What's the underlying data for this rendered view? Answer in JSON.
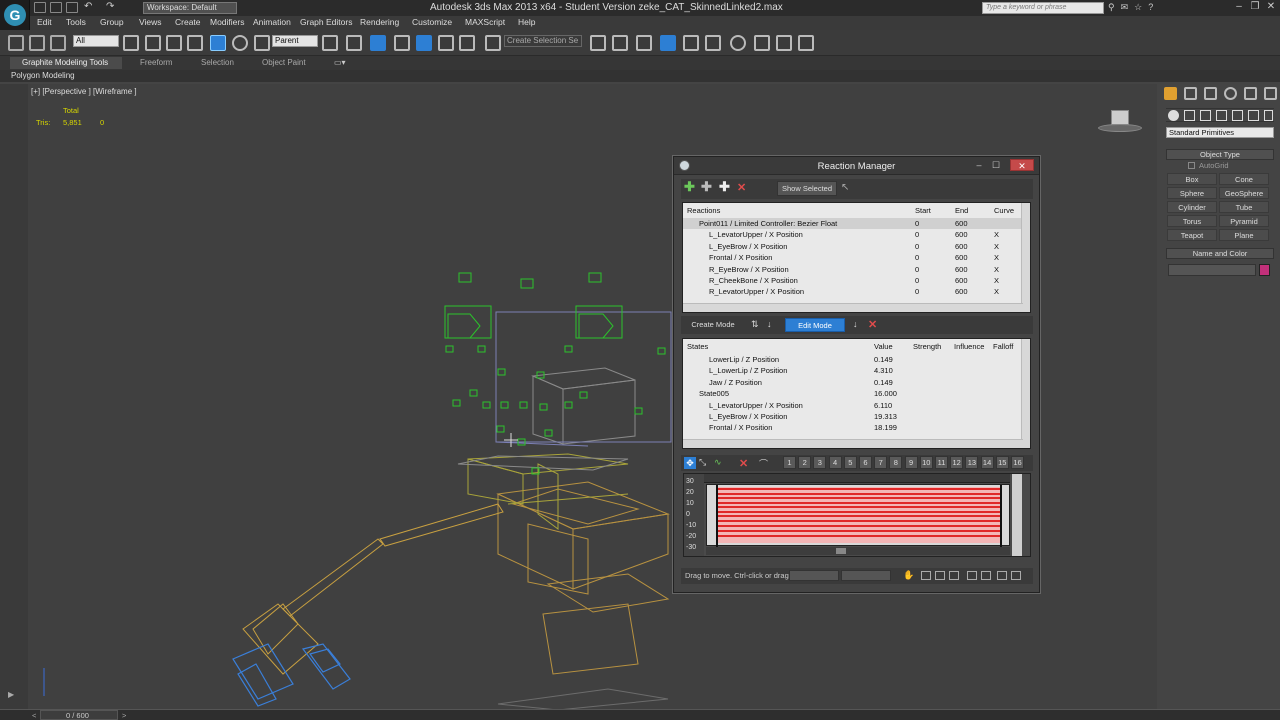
{
  "window": {
    "title": "Autodesk 3ds Max  2013 x64   -  Student Version    zeke_CAT_SkinnedLinked2.max",
    "workspace": "Workspace: Default",
    "help_placeholder": "Type a keyword or phrase"
  },
  "menu": [
    "Edit",
    "Tools",
    "Group",
    "Views",
    "Create",
    "Modifiers",
    "Animation",
    "Graph Editors",
    "Rendering",
    "Customize",
    "MAXScript",
    "Help"
  ],
  "toolbar": {
    "filter": "All",
    "link_mode": "Parent",
    "selection_set": "Create Selection Se"
  },
  "ribbon": {
    "tabs": [
      "Graphite Modeling Tools",
      "Freeform",
      "Selection",
      "Object Paint"
    ],
    "sub_label": "Polygon Modeling"
  },
  "viewport": {
    "label": "[+] [Perspective ] [Wireframe ]",
    "stats_total_label": "Total",
    "stats_tris_label": "Tris:",
    "stats_tris_value": "5,851",
    "stats_tris_sel": "0"
  },
  "command_panel": {
    "dropdown": "Standard Primitives",
    "object_type_header": "Object Type",
    "autogrid": "AutoGrid",
    "primitives": [
      "Box",
      "Cone",
      "Sphere",
      "GeoSphere",
      "Cylinder",
      "Tube",
      "Torus",
      "Pyramid",
      "Teapot",
      "Plane"
    ],
    "name_color_header": "Name and Color",
    "color": "#c2307a"
  },
  "timeline": {
    "frame": "0 / 600"
  },
  "reaction_manager": {
    "title": "Reaction Manager",
    "show_selected": "Show Selected",
    "reactions_headers": [
      "Reactions",
      "Start",
      "End",
      "Curve"
    ],
    "reactions": [
      {
        "name": "Point011 / Limited Controller: Bezier Float",
        "start": "0",
        "end": "600",
        "curve": ""
      },
      {
        "name": "L_LevatorUpper / X Position",
        "start": "0",
        "end": "600",
        "curve": "X"
      },
      {
        "name": "L_EyeBrow / X Position",
        "start": "0",
        "end": "600",
        "curve": "X"
      },
      {
        "name": "Frontal / X Position",
        "start": "0",
        "end": "600",
        "curve": "X"
      },
      {
        "name": "R_EyeBrow / X Position",
        "start": "0",
        "end": "600",
        "curve": "X"
      },
      {
        "name": "R_CheekBone / X Position",
        "start": "0",
        "end": "600",
        "curve": "X"
      },
      {
        "name": "R_LevatorUpper / X Position",
        "start": "0",
        "end": "600",
        "curve": "X"
      }
    ],
    "create_mode": "Create Mode",
    "edit_mode": "Edit Mode",
    "states_headers": [
      "States",
      "Value",
      "Strength",
      "Influence",
      "Falloff"
    ],
    "states": [
      {
        "name": "LowerLip / Z Position",
        "value": "0.149",
        "indent": 2
      },
      {
        "name": "L_LowerLip / Z Position",
        "value": "4.310",
        "indent": 2
      },
      {
        "name": "Jaw / Z Position",
        "value": "0.149",
        "indent": 2
      },
      {
        "name": "State005",
        "value": "16.000",
        "indent": 1
      },
      {
        "name": "L_LevatorUpper / X Position",
        "value": "6.110",
        "indent": 2
      },
      {
        "name": "L_EyeBrow / X Position",
        "value": "19.313",
        "indent": 2
      },
      {
        "name": "Frontal / X Position",
        "value": "18.199",
        "indent": 2
      }
    ],
    "curve_numbers": [
      "1",
      "2",
      "3",
      "4",
      "5",
      "6",
      "7",
      "8",
      "9",
      "10",
      "11",
      "12",
      "13",
      "14",
      "15",
      "16"
    ],
    "graph_y_labels": [
      "30",
      "20",
      "10",
      "0",
      "-10",
      "-20",
      "-30"
    ],
    "status_text": "Drag to move.  Ctrl-click or drag"
  }
}
